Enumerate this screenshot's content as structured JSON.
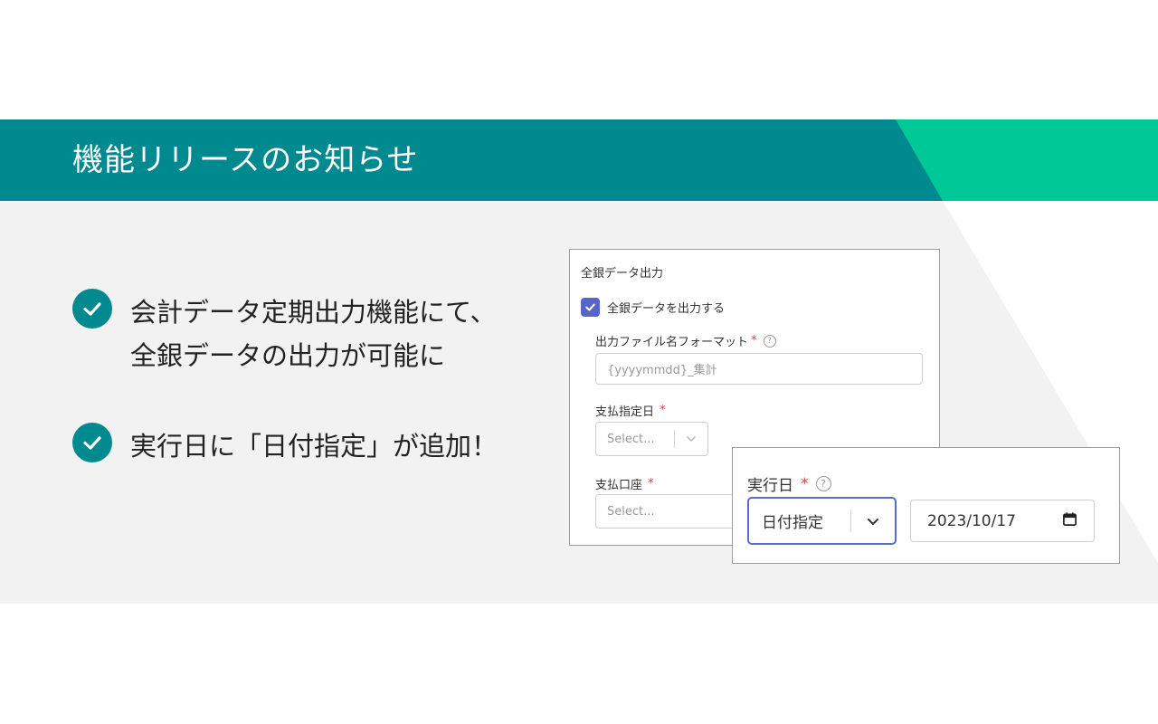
{
  "banner": {
    "title": "機能リリースのお知らせ"
  },
  "bullets": [
    {
      "lines": [
        "会計データ定期出力機能にて、",
        "全銀データの出力が可能に"
      ]
    },
    {
      "lines": [
        "実行日に「日付指定」が追加！"
      ]
    }
  ],
  "zengin_panel": {
    "title": "全銀データ出力",
    "checkbox_label": "全銀データを出力する",
    "checkbox_checked": true,
    "filename_label": "出力ファイル名フォーマット",
    "filename_placeholder": "{yyyymmdd}_集計",
    "payment_date_label": "支払指定日",
    "payment_date_placeholder": "Select...",
    "payment_account_label": "支払口座",
    "payment_account_placeholder": "Select..."
  },
  "execution_panel": {
    "label": "実行日",
    "select_value": "日付指定",
    "date_value": "2023/10/17"
  },
  "colors": {
    "teal": "#00898f",
    "green": "#00c896",
    "checkbox": "#5865c8",
    "required": "#e03a3a",
    "focus_border": "#5b6ad0"
  },
  "icons": {
    "check": "check-circle-icon",
    "help": "question-circle-icon",
    "chevron": "chevron-down-icon",
    "calendar": "calendar-icon"
  }
}
